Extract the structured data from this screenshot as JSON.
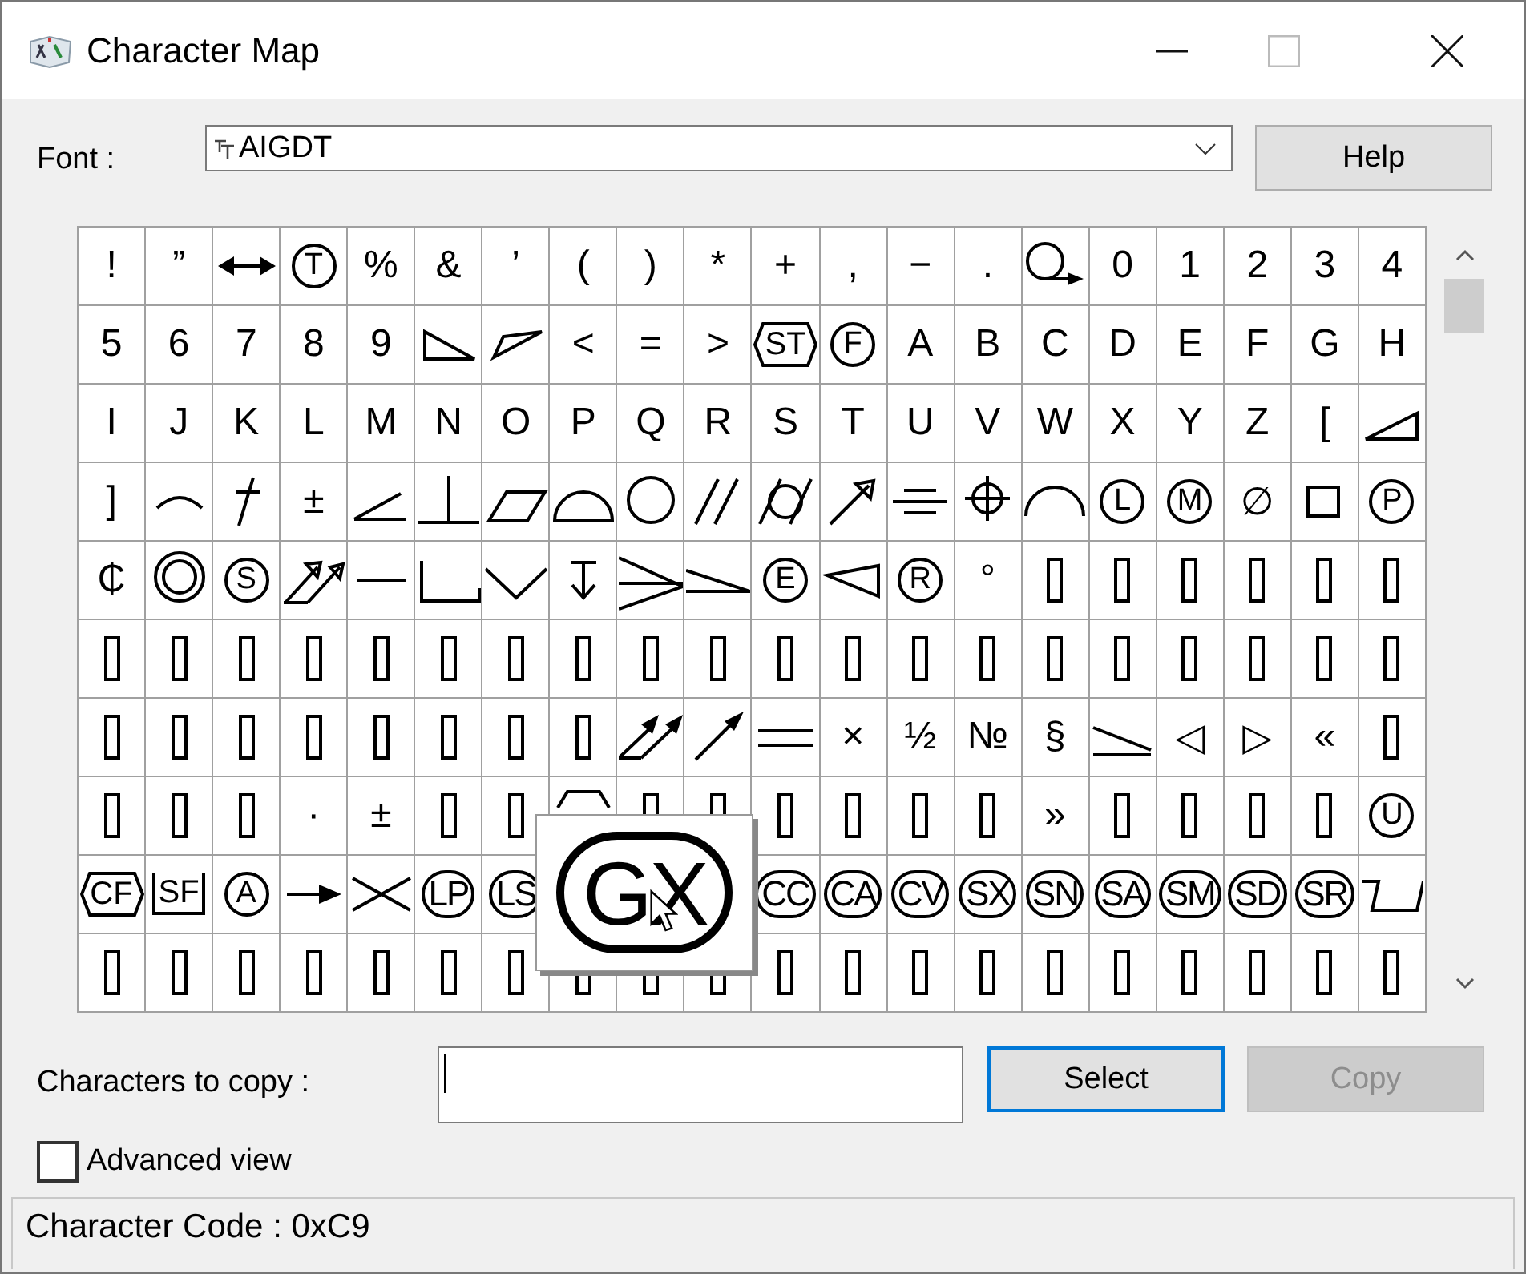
{
  "window": {
    "title": "Character Map"
  },
  "font": {
    "label": "Font :",
    "value": "AIGDT"
  },
  "help_button": {
    "label": "Help"
  },
  "grid": {
    "rows": [
      [
        {
          "kind": "text",
          "char": "!"
        },
        {
          "kind": "text",
          "char": "”"
        },
        {
          "kind": "doublearrow"
        },
        {
          "kind": "circled",
          "char": "T"
        },
        {
          "kind": "text",
          "char": "%"
        },
        {
          "kind": "text",
          "char": "&"
        },
        {
          "kind": "text",
          "char": "’"
        },
        {
          "kind": "text",
          "char": "("
        },
        {
          "kind": "text",
          "char": ")"
        },
        {
          "kind": "text",
          "char": "*"
        },
        {
          "kind": "text",
          "char": "+"
        },
        {
          "kind": "text",
          "char": ","
        },
        {
          "kind": "text",
          "char": "−"
        },
        {
          "kind": "text",
          "char": "."
        },
        {
          "kind": "circlearrow"
        },
        {
          "kind": "text",
          "char": "0"
        },
        {
          "kind": "text",
          "char": "1"
        },
        {
          "kind": "text",
          "char": "2"
        },
        {
          "kind": "text",
          "char": "3"
        },
        {
          "kind": "text",
          "char": "4"
        }
      ],
      [
        {
          "kind": "text",
          "char": "5"
        },
        {
          "kind": "text",
          "char": "6"
        },
        {
          "kind": "text",
          "char": "7"
        },
        {
          "kind": "text",
          "char": "8"
        },
        {
          "kind": "text",
          "char": "9"
        },
        {
          "kind": "taper"
        },
        {
          "kind": "flag"
        },
        {
          "kind": "text",
          "char": "<"
        },
        {
          "kind": "text",
          "char": "="
        },
        {
          "kind": "text",
          "char": ">"
        },
        {
          "kind": "hex",
          "char": "ST"
        },
        {
          "kind": "circled",
          "char": "F"
        },
        {
          "kind": "text",
          "char": "A"
        },
        {
          "kind": "text",
          "char": "B"
        },
        {
          "kind": "text",
          "char": "C"
        },
        {
          "kind": "text",
          "char": "D"
        },
        {
          "kind": "text",
          "char": "E"
        },
        {
          "kind": "text",
          "char": "F"
        },
        {
          "kind": "text",
          "char": "G"
        },
        {
          "kind": "text",
          "char": "H"
        }
      ],
      [
        {
          "kind": "text",
          "char": "I"
        },
        {
          "kind": "text",
          "char": "J"
        },
        {
          "kind": "text",
          "char": "K"
        },
        {
          "kind": "text",
          "char": "L"
        },
        {
          "kind": "text",
          "char": "M"
        },
        {
          "kind": "text",
          "char": "N"
        },
        {
          "kind": "text",
          "char": "O"
        },
        {
          "kind": "text",
          "char": "P"
        },
        {
          "kind": "text",
          "char": "Q"
        },
        {
          "kind": "text",
          "char": "R"
        },
        {
          "kind": "text",
          "char": "S"
        },
        {
          "kind": "text",
          "char": "T"
        },
        {
          "kind": "text",
          "char": "U"
        },
        {
          "kind": "text",
          "char": "V"
        },
        {
          "kind": "text",
          "char": "W"
        },
        {
          "kind": "text",
          "char": "X"
        },
        {
          "kind": "text",
          "char": "Y"
        },
        {
          "kind": "text",
          "char": "Z"
        },
        {
          "kind": "text",
          "char": "["
        },
        {
          "kind": "wedge"
        }
      ],
      [
        {
          "kind": "text",
          "char": "]"
        },
        {
          "kind": "arc"
        },
        {
          "kind": "dagger"
        },
        {
          "kind": "text",
          "char": "±"
        },
        {
          "kind": "angle"
        },
        {
          "kind": "perpendicular"
        },
        {
          "kind": "parallelogram"
        },
        {
          "kind": "semicircle"
        },
        {
          "kind": "circle"
        },
        {
          "kind": "parallel"
        },
        {
          "kind": "cylinder"
        },
        {
          "kind": "arrow"
        },
        {
          "kind": "symmetry"
        },
        {
          "kind": "crosshair"
        },
        {
          "kind": "bigarc"
        },
        {
          "kind": "circled",
          "char": "L"
        },
        {
          "kind": "circled",
          "char": "M"
        },
        {
          "kind": "text",
          "char": "∅"
        },
        {
          "kind": "square"
        },
        {
          "kind": "circled",
          "char": "P"
        }
      ],
      [
        {
          "kind": "text",
          "char": "₵"
        },
        {
          "kind": "doublecircle"
        },
        {
          "kind": "circled",
          "char": "S"
        },
        {
          "kind": "runout"
        },
        {
          "kind": "underline"
        },
        {
          "kind": "counterbore"
        },
        {
          "kind": "countersink"
        },
        {
          "kind": "depth"
        },
        {
          "kind": "conical"
        },
        {
          "kind": "slope"
        },
        {
          "kind": "circled",
          "char": "E"
        },
        {
          "kind": "pennant"
        },
        {
          "kind": "circled",
          "char": "R"
        },
        {
          "kind": "text",
          "char": "°"
        },
        {
          "kind": "missing"
        },
        {
          "kind": "missing"
        },
        {
          "kind": "missing"
        },
        {
          "kind": "missing"
        },
        {
          "kind": "missing"
        },
        {
          "kind": "missing"
        }
      ],
      [
        {
          "kind": "missing"
        },
        {
          "kind": "missing"
        },
        {
          "kind": "missing"
        },
        {
          "kind": "missing"
        },
        {
          "kind": "missing"
        },
        {
          "kind": "missing"
        },
        {
          "kind": "missing"
        },
        {
          "kind": "missing"
        },
        {
          "kind": "missing"
        },
        {
          "kind": "missing"
        },
        {
          "kind": "missing"
        },
        {
          "kind": "missing"
        },
        {
          "kind": "missing"
        },
        {
          "kind": "missing"
        },
        {
          "kind": "missing"
        },
        {
          "kind": "missing"
        },
        {
          "kind": "missing"
        },
        {
          "kind": "missing"
        },
        {
          "kind": "missing"
        },
        {
          "kind": "missing"
        }
      ],
      [
        {
          "kind": "missing"
        },
        {
          "kind": "missing"
        },
        {
          "kind": "missing"
        },
        {
          "kind": "missing"
        },
        {
          "kind": "missing"
        },
        {
          "kind": "missing"
        },
        {
          "kind": "missing"
        },
        {
          "kind": "missing"
        },
        {
          "kind": "runoutfilled"
        },
        {
          "kind": "arrowfilled"
        },
        {
          "kind": "twolines"
        },
        {
          "kind": "text",
          "char": "×"
        },
        {
          "kind": "text",
          "char": "½"
        },
        {
          "kind": "text",
          "char": "№"
        },
        {
          "kind": "text",
          "char": "§"
        },
        {
          "kind": "slopeline"
        },
        {
          "kind": "text",
          "char": "◁"
        },
        {
          "kind": "text",
          "char": "▷"
        },
        {
          "kind": "text",
          "char": "«"
        },
        {
          "kind": "missing"
        }
      ],
      [
        {
          "kind": "missing"
        },
        {
          "kind": "missing"
        },
        {
          "kind": "missing"
        },
        {
          "kind": "text",
          "char": "·"
        },
        {
          "kind": "text",
          "char": "±"
        },
        {
          "kind": "missing"
        },
        {
          "kind": "missing"
        },
        {
          "kind": "hexcut"
        },
        {
          "kind": "missing"
        },
        {
          "kind": "missing"
        },
        {
          "kind": "missing"
        },
        {
          "kind": "missing"
        },
        {
          "kind": "missing"
        },
        {
          "kind": "missing"
        },
        {
          "kind": "text",
          "char": "»"
        },
        {
          "kind": "missing"
        },
        {
          "kind": "missing"
        },
        {
          "kind": "missing"
        },
        {
          "kind": "missing"
        },
        {
          "kind": "circled",
          "char": "U"
        }
      ],
      [
        {
          "kind": "hex",
          "char": "CF"
        },
        {
          "kind": "boxed",
          "char": "SF"
        },
        {
          "kind": "circled",
          "char": "A"
        },
        {
          "kind": "arrowright"
        },
        {
          "kind": "crossing"
        },
        {
          "kind": "pill",
          "char": "LP"
        },
        {
          "kind": "pill",
          "char": "LS"
        },
        null,
        null,
        null,
        {
          "kind": "pill",
          "char": "CC"
        },
        {
          "kind": "pill",
          "char": "CA"
        },
        {
          "kind": "pill",
          "char": "CV"
        },
        {
          "kind": "pill",
          "char": "SX"
        },
        {
          "kind": "pill",
          "char": "SN"
        },
        {
          "kind": "pill",
          "char": "SA"
        },
        {
          "kind": "pill",
          "char": "SM"
        },
        {
          "kind": "pill",
          "char": "SD"
        },
        {
          "kind": "pill",
          "char": "SR"
        },
        {
          "kind": "taperslot"
        }
      ],
      [
        {
          "kind": "missing"
        },
        {
          "kind": "missing"
        },
        {
          "kind": "missing"
        },
        {
          "kind": "missing"
        },
        {
          "kind": "missing"
        },
        {
          "kind": "missing"
        },
        {
          "kind": "missing"
        },
        {
          "kind": "missing"
        },
        {
          "kind": "missing"
        },
        {
          "kind": "missing"
        },
        {
          "kind": "missing"
        },
        {
          "kind": "missing"
        },
        {
          "kind": "missing"
        },
        {
          "kind": "missing"
        },
        {
          "kind": "missing"
        },
        {
          "kind": "missing"
        },
        {
          "kind": "missing"
        },
        {
          "kind": "missing"
        },
        {
          "kind": "missing"
        },
        {
          "kind": "missing"
        }
      ]
    ]
  },
  "magnified": {
    "kind": "pill",
    "char": "GX"
  },
  "copy": {
    "label": "Characters to copy :"
  },
  "buttons": [
    {
      "label": "Select",
      "disabled": false,
      "focused": true
    },
    {
      "label": "Copy",
      "disabled": true,
      "focused": false
    }
  ],
  "advanced_view": {
    "label": "Advanced view",
    "checked": false
  },
  "status_bar": "Character Code : 0xC9"
}
